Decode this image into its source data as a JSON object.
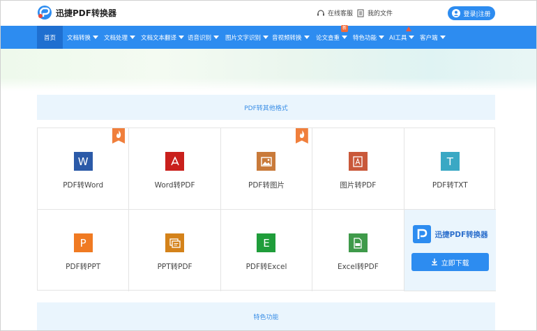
{
  "header": {
    "logo_text": "迅捷PDF转换器",
    "service_label": "在线客服",
    "files_label": "我的文件",
    "login_label": "登录|注册"
  },
  "nav": {
    "items": [
      {
        "label": "首页"
      },
      {
        "label": "文档转换"
      },
      {
        "label": "文档处理"
      },
      {
        "label": "文档文本翻译"
      },
      {
        "label": "语音识别"
      },
      {
        "label": "图片文字识别"
      },
      {
        "label": "音视频转换"
      },
      {
        "label": "论文查重",
        "badge": "新"
      },
      {
        "label": "特色功能"
      },
      {
        "label": "AI工具"
      },
      {
        "label": "客户端"
      }
    ]
  },
  "sections": {
    "pdf_convert_title": "PDF转其他格式",
    "features_title": "特色功能"
  },
  "tools": [
    {
      "label": "PDF转Word",
      "glyph": "W",
      "color": "#2b5aa8",
      "hot": true
    },
    {
      "label": "Word转PDF",
      "glyph": "",
      "color": "#c9201c",
      "hot": false
    },
    {
      "label": "PDF转图片",
      "glyph": "",
      "color": "#c97a3a",
      "hot": true
    },
    {
      "label": "图片转PDF",
      "glyph": "",
      "color": "#c9583a",
      "hot": false
    },
    {
      "label": "PDF转TXT",
      "glyph": "T",
      "color": "#3aa8c4",
      "hot": false
    },
    {
      "label": "PDF转PPT",
      "glyph": "P",
      "color": "#f07a22",
      "hot": false
    },
    {
      "label": "PPT转PDF",
      "glyph": "",
      "color": "#d4821a",
      "hot": false
    },
    {
      "label": "PDF转Excel",
      "glyph": "E",
      "color": "#1f9d3a",
      "hot": false
    },
    {
      "label": "Excel转PDF",
      "glyph": "",
      "color": "#3f9a4a",
      "hot": false
    }
  ],
  "promo": {
    "app_name": "迅捷PDF转换器",
    "download_label": "立即下载"
  },
  "colors": {
    "primary": "#2d8cf0",
    "nav_active": "#1f6fd0",
    "section_bg": "#eaf5fd"
  }
}
